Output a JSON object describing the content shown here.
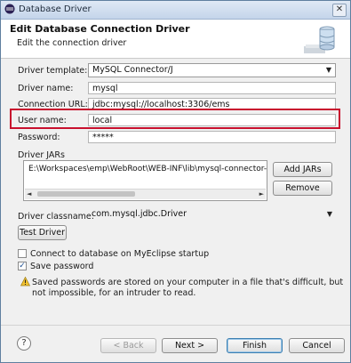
{
  "window": {
    "title": "Database Driver",
    "close_glyph": "✕"
  },
  "header": {
    "title": "Edit Database Connection Driver",
    "subtitle": "Edit the connection driver",
    "icon": "database-icon"
  },
  "form": {
    "driver_template_label": "Driver template:",
    "driver_template_value": "MySQL Connector/J",
    "driver_name_label": "Driver name:",
    "driver_name_value": "mysql",
    "connection_url_label": "Connection URL:",
    "connection_url_value": "jdbc:mysql://localhost:3306/ems",
    "user_name_label": "User name:",
    "user_name_value": "local",
    "password_label": "Password:",
    "password_value": "*****"
  },
  "jars": {
    "label": "Driver JARs",
    "items": [
      "E:\\Workspaces\\emp\\WebRoot\\WEB-INF\\lib\\mysql-connector-"
    ],
    "add_label": "Add JARs",
    "remove_label": "Remove"
  },
  "classname": {
    "label": "Driver classname:",
    "value": "com.mysql.jdbc.Driver"
  },
  "test_driver_label": "Test Driver",
  "options": {
    "connect_startup_label": "Connect to database on MyEclipse startup",
    "connect_startup_checked": false,
    "save_password_label": "Save password",
    "save_password_checked": true,
    "warning_line1": "Saved passwords are stored on your computer in a file that's difficult, but",
    "warning_line2": "not impossible, for an intruder to read."
  },
  "footer": {
    "help_glyph": "?",
    "back_label": "< Back",
    "next_label": "Next >",
    "finish_label": "Finish",
    "cancel_label": "Cancel"
  },
  "colors": {
    "highlight": "#c8102e",
    "accent": "#3c7fb1"
  }
}
